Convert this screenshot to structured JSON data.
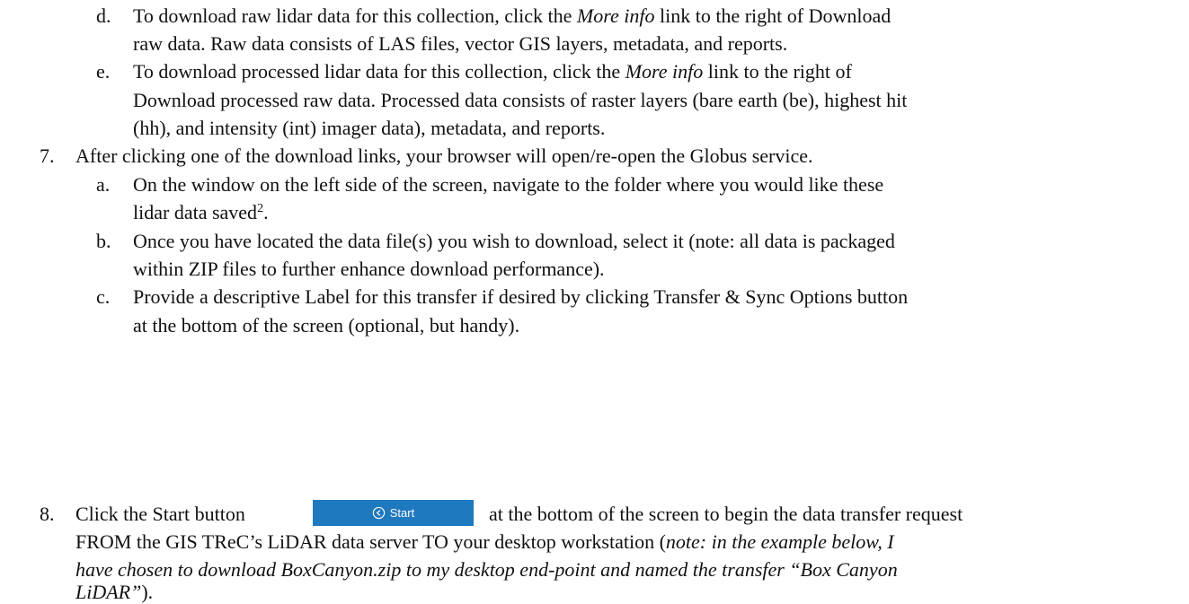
{
  "items": {
    "d": {
      "marker": "d.",
      "line1_pre": "To download raw lidar data for this collection, click the ",
      "line1_em": "More info",
      "line1_post": " link to the right of Download",
      "line2": "raw data. Raw data consists of LAS files, vector GIS layers, metadata, and reports."
    },
    "e": {
      "marker": "e.",
      "line1_pre": "To download processed lidar data for this collection, click the ",
      "line1_em": "More info",
      "line1_post": " link to the right of",
      "line2": "Download processed raw data. Processed data consists of raster layers (bare earth (be), highest hit",
      "line3": "(hh), and intensity (int) imager data), metadata, and reports."
    },
    "step7": {
      "marker": "7.",
      "text": "After clicking one of the download links, your browser will open/re-open the Globus service.",
      "a": {
        "marker": "a.",
        "line1": "On the window on the left side of the screen, navigate to the folder where you would like these",
        "line2": "lidar data saved",
        "footnote": "2",
        "line2_end": "."
      },
      "b": {
        "marker": "b.",
        "line1": "Once you have located the data file(s) you wish to download, select it (note: all data is packaged",
        "line2": "within ZIP files to further enhance download performance)."
      },
      "c": {
        "marker": "c.",
        "line1": "Provide a descriptive Label for this transfer if desired by clicking Transfer & Sync Options button",
        "line2": "at the bottom of the screen (optional, but handy)."
      }
    },
    "step8": {
      "marker": "8.",
      "line1_pre": "Click the Start button",
      "line1_post": "at the bottom of the screen to begin the data transfer request",
      "line2_pre": "FROM the GIS TReC’s LiDAR data server TO your desktop workstation (",
      "line2_em": "note: in the example below, I",
      "line3_em": "have chosen to download BoxCanyon.zip to my desktop end-point and named the transfer “Box Canyon",
      "line4_em": "LiDAR”",
      "line4_post": ")."
    }
  },
  "start_button": {
    "label": "Start",
    "icon": "circle-arrow-left-icon",
    "color": "#1f79bf"
  }
}
